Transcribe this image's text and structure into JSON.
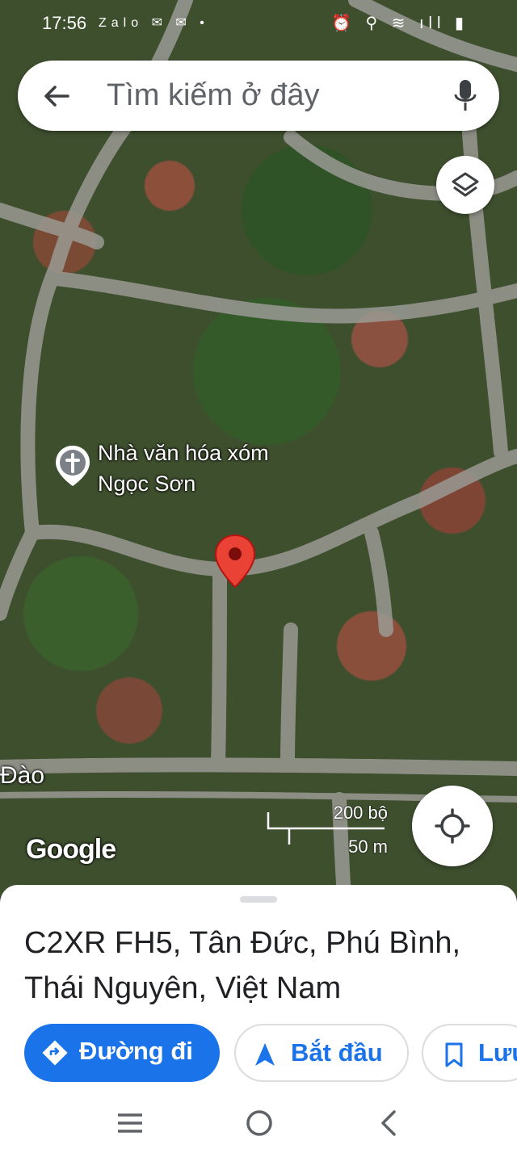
{
  "status_bar": {
    "time": "17:56",
    "app_badges": "Zalo ✉ ✉ •",
    "status_icons": "⏰ ⚲ ≋ ıll ▮"
  },
  "search": {
    "placeholder": "Tìm kiếm ở đây"
  },
  "map": {
    "poi_label": "Nhà văn hóa xóm Ngọc Sơn",
    "road_label": "Đào",
    "scale_top": "200 bộ",
    "scale_bottom": "50 m",
    "attribution": "Google"
  },
  "place": {
    "address": "C2XR FH5, Tân Đức, Phú Bình, Thái Nguyên, Việt Nam"
  },
  "actions": {
    "directions": "Đường đi",
    "start": "Bắt đầu",
    "save": "Lưu"
  },
  "colors": {
    "accent": "#1a73e8",
    "pin": "#ea4335"
  }
}
